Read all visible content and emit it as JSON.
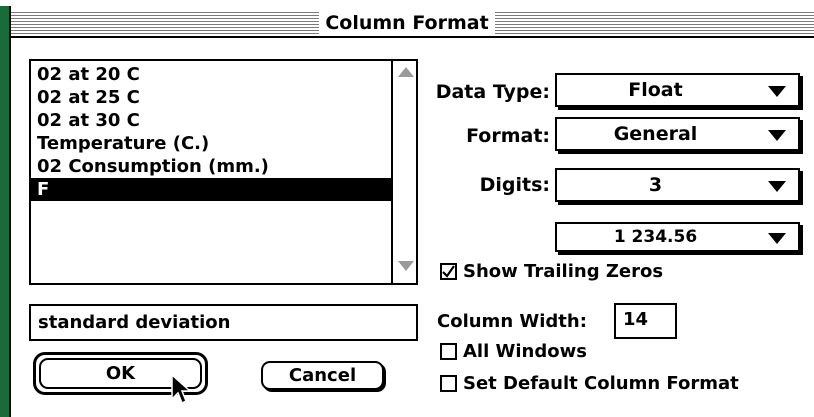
{
  "window": {
    "title": "Column Format"
  },
  "column_list": {
    "items": [
      "02 at 20 C",
      "02 at 25 C",
      "02 at 30 C",
      "Temperature (C.)",
      "02 Consumption (mm.)",
      "F"
    ],
    "selected_index": 5
  },
  "name_field": {
    "value": "standard deviation"
  },
  "buttons": {
    "ok": "OK",
    "cancel": "Cancel"
  },
  "data_type": {
    "label": "Data Type:",
    "value": "Float"
  },
  "format": {
    "label": "Format:",
    "value": "General"
  },
  "digits": {
    "label": "Digits:",
    "value": "3"
  },
  "number_style": {
    "value": "1 234.56"
  },
  "show_trailing_zeros": {
    "label": "Show Trailing Zeros",
    "checked": true
  },
  "column_width": {
    "label": "Column Width:",
    "value": "14"
  },
  "all_windows": {
    "label": "All Windows",
    "checked": false
  },
  "set_default": {
    "label": "Set Default Column Format",
    "checked": false
  },
  "colors": {
    "desktop_green": "#1a6b3a",
    "selection": "#000000",
    "scroll_arrow": "#9a9a9a"
  }
}
